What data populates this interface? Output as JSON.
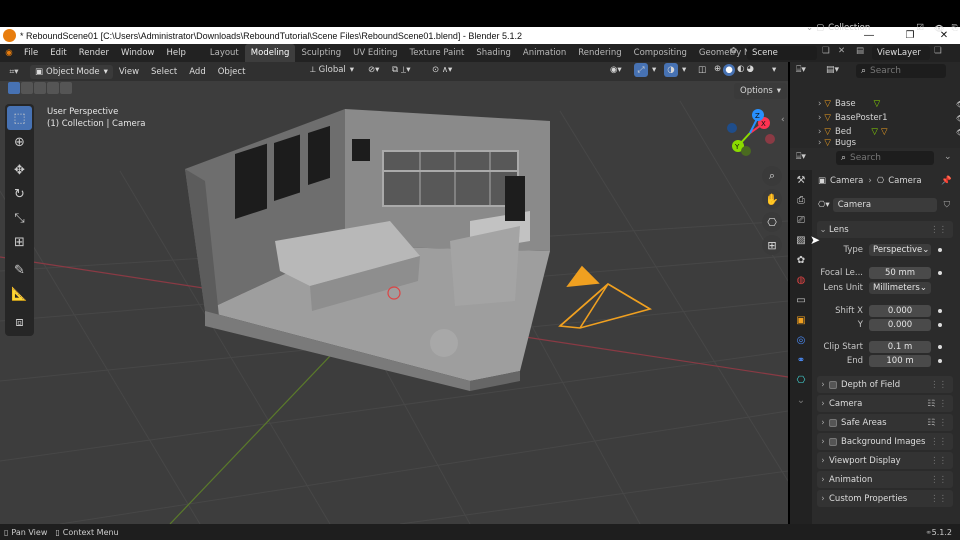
{
  "window": {
    "title": "* ReboundScene01 [C:\\Users\\Administrator\\Downloads\\ReboundTutorial\\Scene Files\\ReboundScene01.blend] - Blender 5.1.2",
    "minimize": "—",
    "restore": "❐",
    "close": "✕"
  },
  "menu": {
    "items": [
      "File",
      "Edit",
      "Render",
      "Window",
      "Help"
    ],
    "workspaces": [
      "Layout",
      "Modeling",
      "Sculpting",
      "UV Editing",
      "Texture Paint",
      "Shading",
      "Animation",
      "Rendering",
      "Compositing",
      "Geometry Node"
    ],
    "active_workspace": "Modeling",
    "scene": "Scene",
    "view_layer": "ViewLayer"
  },
  "viewport_header": {
    "mode": "Object Mode",
    "menus": [
      "View",
      "Select",
      "Add",
      "Object"
    ],
    "orientation": "Global",
    "options": "Options"
  },
  "viewport": {
    "perspective": "User Perspective",
    "context": "(1) Collection | Camera",
    "gizmo": {
      "x": "X",
      "y": "Y",
      "z": "Z"
    }
  },
  "outliner": {
    "search_placeholder": "Search",
    "collection": "Collection",
    "items": [
      "Base",
      "BasePoster1",
      "Bed",
      "Bugs"
    ]
  },
  "properties": {
    "search_placeholder": "Search",
    "breadcrumb": [
      "Camera",
      "Camera"
    ],
    "datablock": "Camera",
    "lens_panel": "Lens",
    "fields": {
      "type_label": "Type",
      "type_value": "Perspective",
      "focal_label": "Focal Le...",
      "focal_value": "50 mm",
      "unit_label": "Lens Unit",
      "unit_value": "Millimeters",
      "shiftx_label": "Shift X",
      "shiftx_value": "0.000",
      "y_label": "Y",
      "y_value": "0.000",
      "clipstart_label": "Clip Start",
      "clipstart_value": "0.1 m",
      "end_label": "End",
      "end_value": "100 m"
    },
    "panels": [
      "Depth of Field",
      "Camera",
      "Safe Areas",
      "Background Images",
      "Viewport Display",
      "Animation",
      "Custom Properties"
    ]
  },
  "status": {
    "pan": "Pan View",
    "context_menu": "Context Menu",
    "version": "5.1.2"
  },
  "colors": {
    "accent": "#4772b3",
    "camera": "#f0a020",
    "axis_x": "#ff3352",
    "axis_y": "#8bdc00",
    "axis_z": "#2890ff"
  }
}
